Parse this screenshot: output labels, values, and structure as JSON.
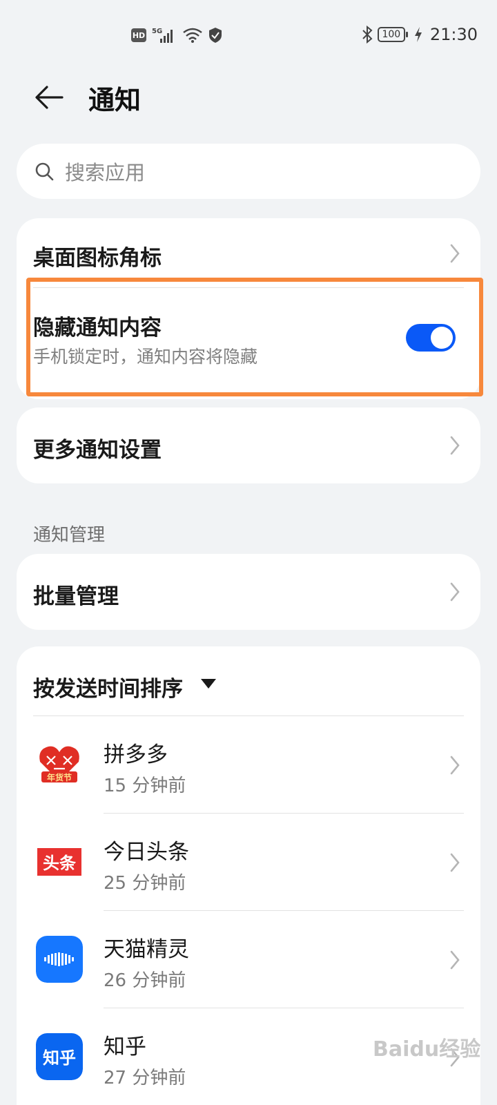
{
  "status_bar": {
    "hd": "HD",
    "network": "5G",
    "battery": "100",
    "time": "21:30"
  },
  "header": {
    "title": "通知"
  },
  "search": {
    "placeholder": "搜索应用"
  },
  "settings": {
    "badge_label": "桌面图标角标",
    "hide_content_label": "隐藏通知内容",
    "hide_content_desc": "手机锁定时，通知内容将隐藏",
    "hide_content_enabled": true,
    "more_label": "更多通知设置"
  },
  "management": {
    "section_label": "通知管理",
    "batch_label": "批量管理"
  },
  "sort": {
    "label": "按发送时间排序"
  },
  "apps": [
    {
      "name": "拼多多",
      "time": "15 分钟前",
      "icon": "pinduoduo-icon"
    },
    {
      "name": "今日头条",
      "time": "25 分钟前",
      "icon": "toutiao-icon"
    },
    {
      "name": "天猫精灵",
      "time": "26 分钟前",
      "icon": "tmall-genie-icon"
    },
    {
      "name": "知乎",
      "time": "27 分钟前",
      "icon": "zhihu-icon"
    }
  ],
  "icon_text": {
    "pinduoduo_badge": "年货节",
    "toutiao": "头条",
    "zhihu": "知乎"
  },
  "watermark": "Baidu经验",
  "colors": {
    "accent": "#0a59f7",
    "highlight": "#f7883c",
    "background": "#f1f3f5"
  }
}
